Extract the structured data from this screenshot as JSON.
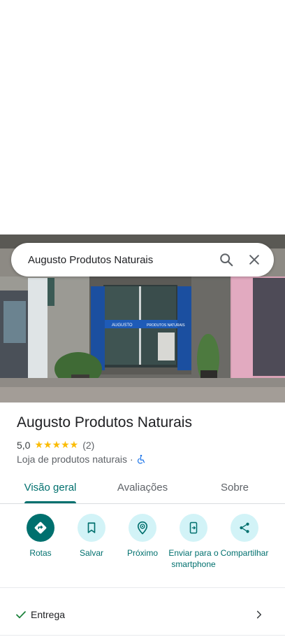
{
  "search": {
    "query": "Augusto Produtos Naturais"
  },
  "place": {
    "name": "Augusto Produtos Naturais",
    "rating": "5,0",
    "stars": "★★★★★",
    "review_count": "(2)",
    "category": "Loja de produtos naturais",
    "separator": "·"
  },
  "storefront": {
    "sign_left": "AUGUSTO",
    "sign_right": "PRODUTOS NATURAIS"
  },
  "tabs": [
    {
      "label": "Visão geral",
      "active": true
    },
    {
      "label": "Avaliações",
      "active": false
    },
    {
      "label": "Sobre",
      "active": false
    }
  ],
  "actions": [
    {
      "label": "Rotas",
      "icon": "directions-icon"
    },
    {
      "label": "Salvar",
      "icon": "bookmark-icon"
    },
    {
      "label": "Próximo",
      "icon": "nearby-icon"
    },
    {
      "label": "Enviar para o smartphone",
      "icon": "send-to-phone-icon"
    },
    {
      "label": "Compartilhar",
      "icon": "share-icon"
    }
  ],
  "rows": {
    "delivery": "Entrega"
  },
  "colors": {
    "accent": "#00706e",
    "star": "#fbbc04",
    "action_bg": "#d2f3f7"
  }
}
